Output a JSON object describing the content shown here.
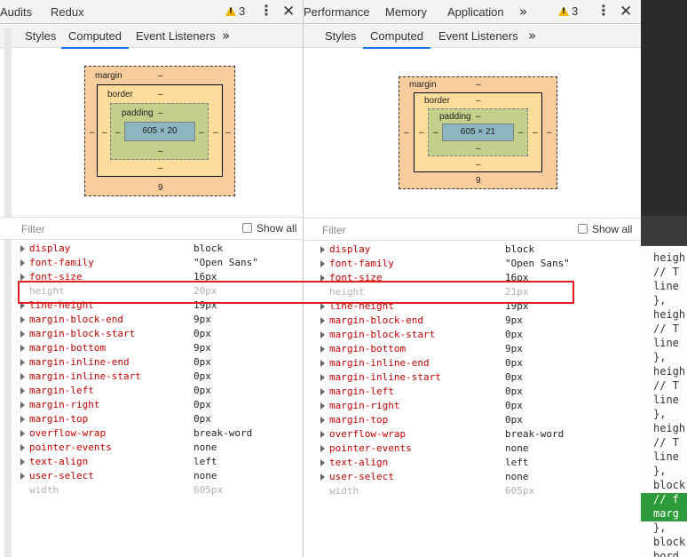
{
  "left": {
    "top_tabs": [
      "Audits",
      "Redux"
    ],
    "warning_count": "3",
    "sub_tabs": [
      "Styles",
      "Computed",
      "Event Listeners"
    ],
    "active_sub_tab": "Computed",
    "box_model": {
      "margin_label": "margin",
      "border_label": "border",
      "padding_label": "padding",
      "dash": "–",
      "content": "605 × 20",
      "margin_bottom": "9"
    },
    "filter_placeholder": "Filter",
    "show_all_label": "Show all",
    "properties": [
      {
        "name": "display",
        "value": "block",
        "inherited": false
      },
      {
        "name": "font-family",
        "value": "\"Open Sans\"",
        "inherited": false
      },
      {
        "name": "font-size",
        "value": "16px",
        "inherited": false
      },
      {
        "name": "height",
        "value": "20px",
        "inherited": true
      },
      {
        "name": "line-height",
        "value": "19px",
        "inherited": false
      },
      {
        "name": "margin-block-end",
        "value": "9px",
        "inherited": false
      },
      {
        "name": "margin-block-start",
        "value": "0px",
        "inherited": false
      },
      {
        "name": "margin-bottom",
        "value": "9px",
        "inherited": false
      },
      {
        "name": "margin-inline-end",
        "value": "0px",
        "inherited": false
      },
      {
        "name": "margin-inline-start",
        "value": "0px",
        "inherited": false
      },
      {
        "name": "margin-left",
        "value": "0px",
        "inherited": false
      },
      {
        "name": "margin-right",
        "value": "0px",
        "inherited": false
      },
      {
        "name": "margin-top",
        "value": "0px",
        "inherited": false
      },
      {
        "name": "overflow-wrap",
        "value": "break-word",
        "inherited": false
      },
      {
        "name": "pointer-events",
        "value": "none",
        "inherited": false
      },
      {
        "name": "text-align",
        "value": "left",
        "inherited": false
      },
      {
        "name": "user-select",
        "value": "none",
        "inherited": false
      },
      {
        "name": "width",
        "value": "605px",
        "inherited": true
      }
    ]
  },
  "right": {
    "top_tabs": [
      "Performance",
      "Memory",
      "Application"
    ],
    "warning_count": "3",
    "sub_tabs": [
      "Styles",
      "Computed",
      "Event Listeners"
    ],
    "active_sub_tab": "Computed",
    "box_model": {
      "margin_label": "margin",
      "border_label": "border",
      "padding_label": "padding",
      "dash": "–",
      "content": "605 × 21",
      "margin_bottom": "9"
    },
    "filter_placeholder": "Filter",
    "show_all_label": "Show all",
    "properties": [
      {
        "name": "display",
        "value": "block",
        "inherited": false
      },
      {
        "name": "font-family",
        "value": "\"Open Sans\"",
        "inherited": false
      },
      {
        "name": "font-size",
        "value": "16px",
        "inherited": false
      },
      {
        "name": "height",
        "value": "21px",
        "inherited": true
      },
      {
        "name": "line-height",
        "value": "19px",
        "inherited": false
      },
      {
        "name": "margin-block-end",
        "value": "9px",
        "inherited": false
      },
      {
        "name": "margin-block-start",
        "value": "0px",
        "inherited": false
      },
      {
        "name": "margin-bottom",
        "value": "9px",
        "inherited": false
      },
      {
        "name": "margin-inline-end",
        "value": "0px",
        "inherited": false
      },
      {
        "name": "margin-inline-start",
        "value": "0px",
        "inherited": false
      },
      {
        "name": "margin-left",
        "value": "0px",
        "inherited": false
      },
      {
        "name": "margin-right",
        "value": "0px",
        "inherited": false
      },
      {
        "name": "margin-top",
        "value": "0px",
        "inherited": false
      },
      {
        "name": "overflow-wrap",
        "value": "break-word",
        "inherited": false
      },
      {
        "name": "pointer-events",
        "value": "none",
        "inherited": false
      },
      {
        "name": "text-align",
        "value": "left",
        "inherited": false
      },
      {
        "name": "user-select",
        "value": "none",
        "inherited": false
      },
      {
        "name": "width",
        "value": "605px",
        "inherited": true
      }
    ]
  },
  "code_edge": {
    "lines": [
      {
        "text": "heigh",
        "hl": false
      },
      {
        "text": "  // T",
        "hl": false
      },
      {
        "text": "  line",
        "hl": false
      },
      {
        "text": "},",
        "hl": false
      },
      {
        "text": "heigh",
        "hl": false
      },
      {
        "text": "  // T",
        "hl": false
      },
      {
        "text": "  line",
        "hl": false
      },
      {
        "text": "},",
        "hl": false
      },
      {
        "text": "heigh",
        "hl": false
      },
      {
        "text": "  // T",
        "hl": false
      },
      {
        "text": "  line",
        "hl": false
      },
      {
        "text": "},",
        "hl": false
      },
      {
        "text": "heigh",
        "hl": false
      },
      {
        "text": "  // T",
        "hl": false
      },
      {
        "text": "  line",
        "hl": false
      },
      {
        "text": "},",
        "hl": false
      },
      {
        "text": "block",
        "hl": false
      },
      {
        "text": "  // f",
        "hl": true
      },
      {
        "text": "  marg",
        "hl": true
      },
      {
        "text": "},",
        "hl": false
      },
      {
        "text": "block",
        "hl": false
      },
      {
        "text": "  bord",
        "hl": false
      }
    ]
  },
  "icons": {
    "kebab": "⋮",
    "close": "✕",
    "chevron": "»"
  },
  "colors": {
    "prop_name": "#c80000",
    "active_tab_underline": "#1a73e8",
    "warning": "#f1b400",
    "highlight_box": "#e02020"
  }
}
